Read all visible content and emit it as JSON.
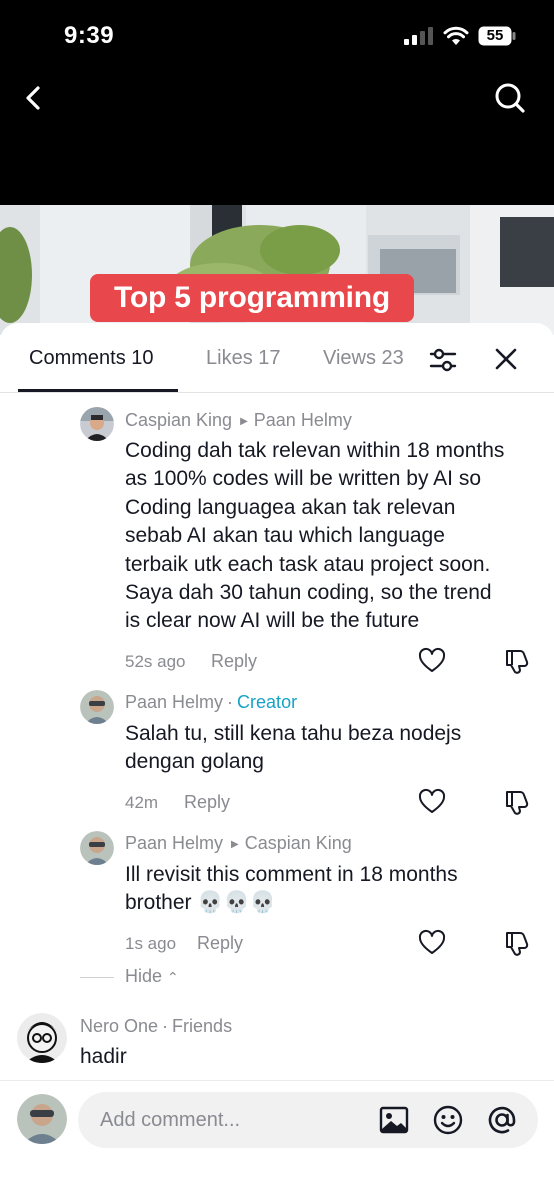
{
  "status_bar": {
    "time": "9:39",
    "battery": "55"
  },
  "video": {
    "title_overlay": "Top 5 programming"
  },
  "tabs": [
    {
      "label": "Comments 10",
      "active": true
    },
    {
      "label": "Likes 17",
      "active": false
    },
    {
      "label": "Views 23",
      "active": false
    }
  ],
  "comments": [
    {
      "author": "Caspian King",
      "reply_to": "Paan Helmy",
      "text_lines": [
        "Coding dah tak relevan within 18 months",
        "as 100% codes will be written by AI so",
        "Coding languagea akan tak relevan",
        "sebab AI akan tau which language",
        "terbaik utk each task atau project soon.",
        "Saya dah 30 tahun coding, so the trend",
        "is clear now AI will be the future"
      ],
      "time": "52s ago",
      "reply_label": "Reply"
    },
    {
      "author": "Paan Helmy",
      "separator": "·",
      "badge": "Creator",
      "text_lines": [
        "Salah tu, still kena tahu beza nodejs",
        "dengan golang"
      ],
      "time": "42m",
      "reply_label": "Reply"
    },
    {
      "author": "Paan Helmy",
      "reply_to": "Caspian King",
      "text_lines": [
        "Ill revisit this comment in 18 months",
        "brother 💀💀💀"
      ],
      "time": "1s ago",
      "reply_label": "Reply"
    },
    {
      "author": "Nero One",
      "separator": "·",
      "badge": "Friends",
      "text_lines": [
        "hadir"
      ]
    }
  ],
  "hide_label": "Hide",
  "input": {
    "placeholder": "Add comment..."
  },
  "icons": {
    "back": "chevron-left-icon",
    "search": "search-icon",
    "filter": "sliders-icon",
    "close": "close-icon",
    "like": "heart-icon",
    "dislike": "thumbs-down-icon",
    "image": "image-icon",
    "emoji": "emoji-icon",
    "mention": "at-sign-icon"
  },
  "colors": {
    "creator_badge": "#16a3c5",
    "title_overlay": "#e8474b",
    "tab_active": "#161823",
    "muted_text": "#8a8b91"
  }
}
